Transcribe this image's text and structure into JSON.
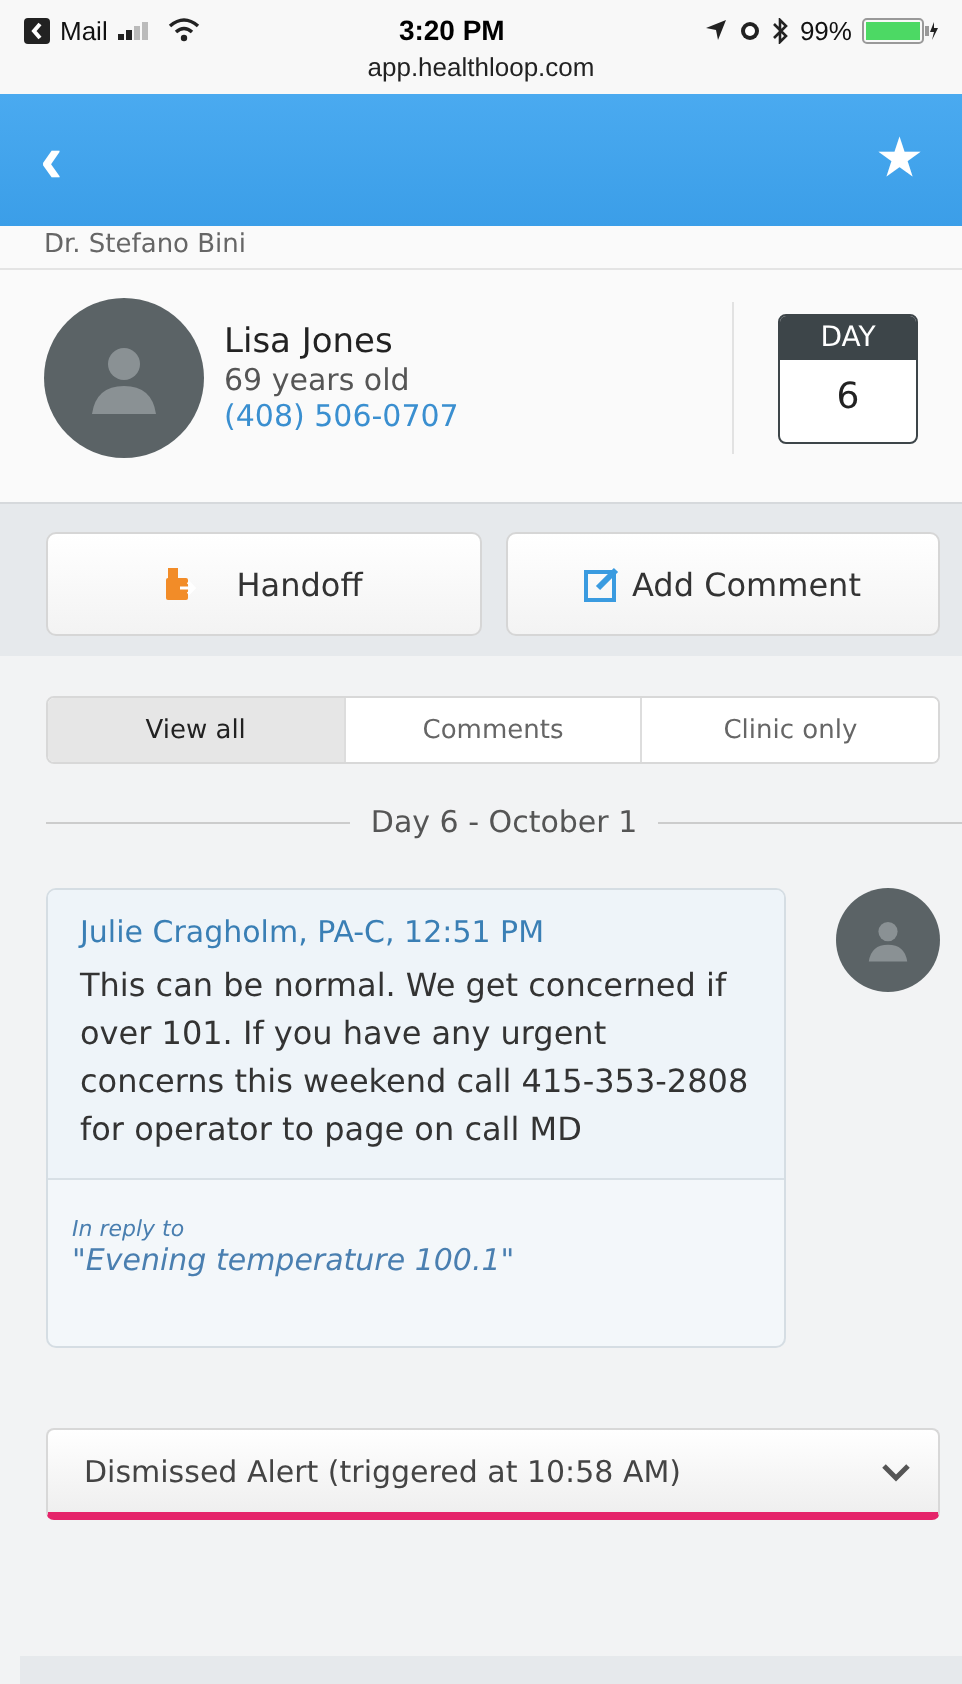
{
  "status_bar": {
    "back_app": "Mail",
    "time": "3:20 PM",
    "battery": "99%",
    "url": "app.healthloop.com"
  },
  "header": {
    "back": "‹",
    "star": "★"
  },
  "provider": "Dr. Stefano Bini",
  "patient": {
    "name": "Lisa Jones",
    "age": "69 years old",
    "phone": "(408) 506-0707"
  },
  "day_badge": {
    "label": "DAY",
    "value": "6"
  },
  "actions": [
    {
      "kind": "handoff",
      "label": "Handoff"
    },
    {
      "kind": "comment",
      "label": "Add Comment"
    }
  ],
  "tabs": [
    {
      "label": "View all",
      "selected": true
    },
    {
      "label": "Comments",
      "selected": false
    },
    {
      "label": "Clinic only",
      "selected": false
    }
  ],
  "day_divider": "Day 6 - October 1",
  "message": {
    "author": "Julie Cragholm, PA-C, 12:51 PM",
    "body": "This can be normal. We get concerned if over 101. If you have any urgent concerns this weekend call 415-353-2808 for operator to page on call MD",
    "reply_label": "In reply to",
    "reply_text": "\"Evening temperature 100.1\""
  },
  "alert": {
    "label": "Dismissed Alert (triggered at 10:58 AM)",
    "expanded": false
  }
}
